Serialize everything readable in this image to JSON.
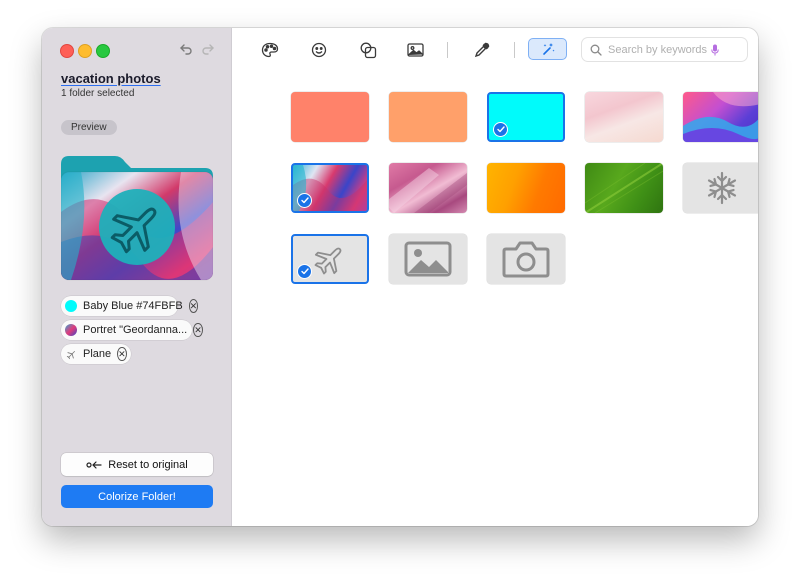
{
  "window": {
    "folder_name": "vacation photos",
    "folder_subtitle": "1 folder selected",
    "preview_label": "Preview"
  },
  "toolbar": {
    "tabs": [
      {
        "name": "palette",
        "icon": "palette-icon"
      },
      {
        "name": "emoji",
        "icon": "smiley-icon"
      },
      {
        "name": "shapes",
        "icon": "shapes-icon"
      },
      {
        "name": "images",
        "icon": "image-icon"
      },
      {
        "name": "eyedropper",
        "icon": "eyedropper-icon"
      },
      {
        "name": "magic",
        "icon": "magic-wand-icon",
        "active": true
      }
    ],
    "search_placeholder": "Search by keywords"
  },
  "chips": [
    {
      "label": "Baby Blue #74FBFB",
      "color": "#00FBFB"
    },
    {
      "label": "Portret \"Geordanna...",
      "icon": "portrait-thumbnail"
    },
    {
      "label": "Plane",
      "icon": "plane-icon"
    }
  ],
  "buttons": {
    "reset": "Reset to original",
    "colorize": "Colorize Folder!"
  },
  "tiles": [
    {
      "name": "coral",
      "color": "#ff826a"
    },
    {
      "name": "peach",
      "color": "#ffa06a"
    },
    {
      "name": "baby-blue",
      "color": "#00fbfb",
      "selected": true
    },
    {
      "name": "pink-silk",
      "type": "wallpaper"
    },
    {
      "name": "purple-waves",
      "type": "wallpaper"
    },
    {
      "name": "paint-swirl",
      "type": "wallpaper",
      "selected": true
    },
    {
      "name": "pink-texture",
      "type": "wallpaper"
    },
    {
      "name": "orange-gradient",
      "type": "wallpaper"
    },
    {
      "name": "green-leaf",
      "type": "wallpaper"
    },
    {
      "name": "snowflake",
      "type": "icon",
      "icon": "snowflake-icon"
    },
    {
      "name": "plane",
      "type": "icon",
      "icon": "plane-icon",
      "selected": true
    },
    {
      "name": "image",
      "type": "icon",
      "icon": "image-icon"
    },
    {
      "name": "camera",
      "type": "icon",
      "icon": "camera-icon"
    }
  ],
  "colors": {
    "accent": "#1a73e8",
    "button_primary": "#1e7bf3",
    "sidebar_bg": "#dedae0",
    "folder_teal": "#1fb0ba"
  }
}
